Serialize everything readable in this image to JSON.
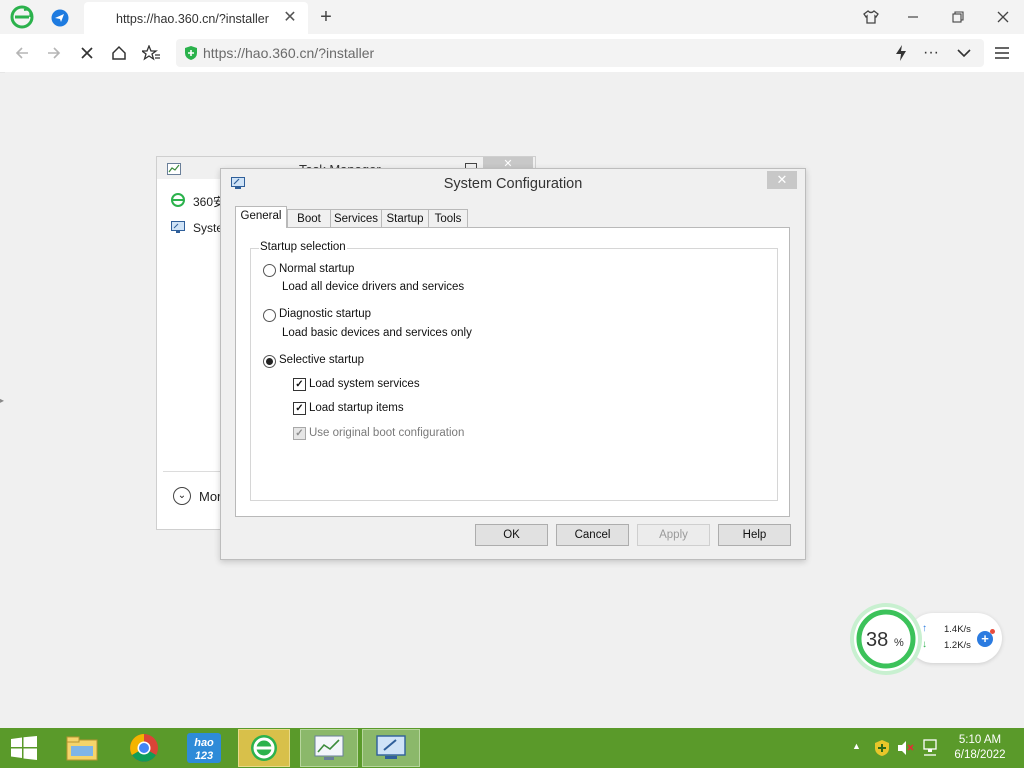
{
  "browser": {
    "tab_title": "https://hao.360.cn/?installer",
    "address": "https://hao.360.cn/?installer",
    "accent": "#2bb24c"
  },
  "task_manager": {
    "title": "Task Manager",
    "items": [
      {
        "label": "360安",
        "icon": "360-browser-icon"
      },
      {
        "label": "Syste",
        "icon": "system-config-icon"
      }
    ],
    "more_label": "Mor"
  },
  "dialog": {
    "title": "System Configuration",
    "tabs": [
      "General",
      "Boot",
      "Services",
      "Startup",
      "Tools"
    ],
    "active_tab": "General",
    "group_label": "Startup selection",
    "options": [
      {
        "label": "Normal startup",
        "description": "Load all device drivers and services",
        "selected": false
      },
      {
        "label": "Diagnostic startup",
        "description": "Load basic devices and services only",
        "selected": false
      },
      {
        "label": "Selective startup",
        "selected": true
      }
    ],
    "checkboxes": [
      {
        "label": "Load system services",
        "checked": true,
        "enabled": true
      },
      {
        "label": "Load startup items",
        "checked": true,
        "enabled": true
      },
      {
        "label": "Use original boot configuration",
        "checked": true,
        "enabled": false
      }
    ],
    "buttons": {
      "ok": "OK",
      "cancel": "Cancel",
      "apply": "Apply",
      "help": "Help"
    }
  },
  "speed_widget": {
    "percent": "38",
    "percent_unit": "%",
    "upload": "1.4K/s",
    "download": "1.2K/s",
    "ring_color": "#3cc25a"
  },
  "taskbar": {
    "color": "#5a9a2a",
    "time": "5:10 AM",
    "date": "6/18/2022",
    "apps": [
      "start-button",
      "file-explorer",
      "chrome",
      "hao123",
      "360-browser",
      "task-manager",
      "system-configuration"
    ]
  }
}
